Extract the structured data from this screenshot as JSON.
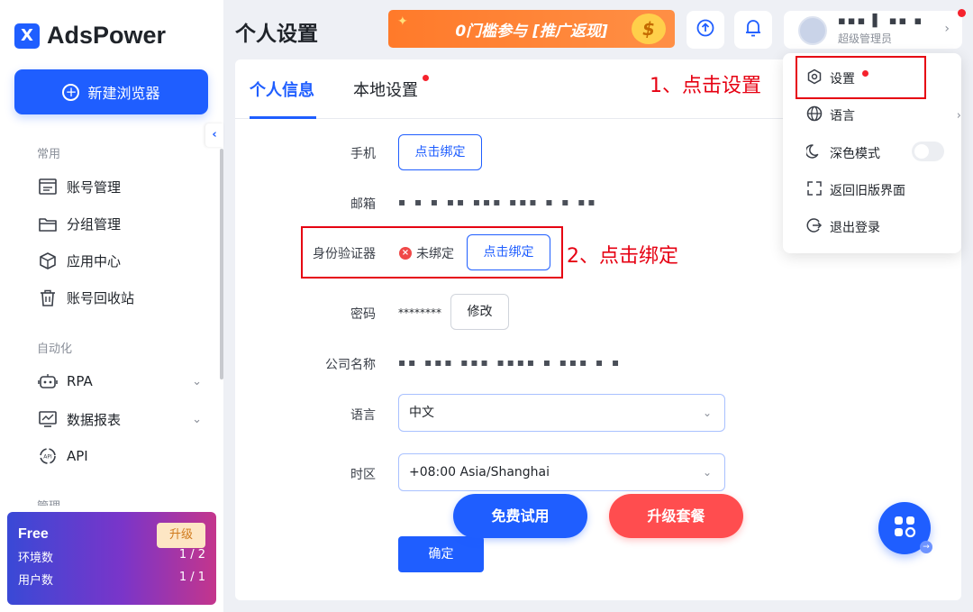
{
  "app": {
    "name": "AdsPower"
  },
  "sidebar": {
    "new_browser": "新建浏览器",
    "sections": [
      {
        "label": "常用",
        "items": [
          {
            "label": "账号管理",
            "icon": "account-list-icon"
          },
          {
            "label": "分组管理",
            "icon": "folder-icon"
          },
          {
            "label": "应用中心",
            "icon": "cube-icon"
          },
          {
            "label": "账号回收站",
            "icon": "trash-icon"
          }
        ]
      },
      {
        "label": "自动化",
        "items": [
          {
            "label": "RPA",
            "icon": "robot-icon"
          },
          {
            "label": "数据报表",
            "icon": "chart-icon"
          },
          {
            "label": "API",
            "icon": "api-icon"
          }
        ]
      },
      {
        "label": "管理"
      }
    ],
    "plan": {
      "name": "Free",
      "upgrade": "升级",
      "rows": [
        {
          "label": "环境数",
          "value": "1 / 2"
        },
        {
          "label": "用户数",
          "value": "1 / 1"
        }
      ]
    }
  },
  "header": {
    "title": "个人设置",
    "banner": "0门槛参与 [推广返现]",
    "user": {
      "name": "▪▪▪ ▌ ▪▪ ▪",
      "role": "超级管理员"
    }
  },
  "tabs": [
    {
      "label": "个人信息",
      "active": true
    },
    {
      "label": "本地设置",
      "active": false,
      "dot": true
    }
  ],
  "form": {
    "phone": {
      "label": "手机",
      "button": "点击绑定"
    },
    "email": {
      "label": "邮箱",
      "value": "▪ ▪ ▪ ▪▪ ▪▪▪ ▪▪▪ ▪ ▪ ▪▪"
    },
    "auth": {
      "label": "身份验证器",
      "status": "未绑定",
      "button": "点击绑定"
    },
    "password": {
      "label": "密码",
      "value": "********",
      "button": "修改"
    },
    "company": {
      "label": "公司名称",
      "value": "▪▪ ▪▪▪ ▪▪▪ ▪▪▪▪ ▪ ▪▪▪ ▪ ▪"
    },
    "language": {
      "label": "语言",
      "value": "中文"
    },
    "timezone": {
      "label": "时区",
      "value": "+08:00 Asia/Shanghai"
    },
    "save": "确定"
  },
  "promo": {
    "trial": "免费试用",
    "upgrade": "升级套餐"
  },
  "user_menu": [
    {
      "label": "设置",
      "icon": "settings-icon",
      "dot": true
    },
    {
      "label": "语言",
      "icon": "globe-icon",
      "chevron": true
    },
    {
      "label": "深色模式",
      "icon": "moon-icon",
      "toggle": true
    },
    {
      "label": "返回旧版界面",
      "icon": "switch-version-icon"
    },
    {
      "label": "退出登录",
      "icon": "logout-icon"
    }
  ],
  "annotations": {
    "step1": "1、点击设置",
    "step2": "2、点击绑定"
  },
  "colors": {
    "primary": "#1f5eff",
    "danger": "#ff4d4f",
    "annotation": "#e60012"
  }
}
